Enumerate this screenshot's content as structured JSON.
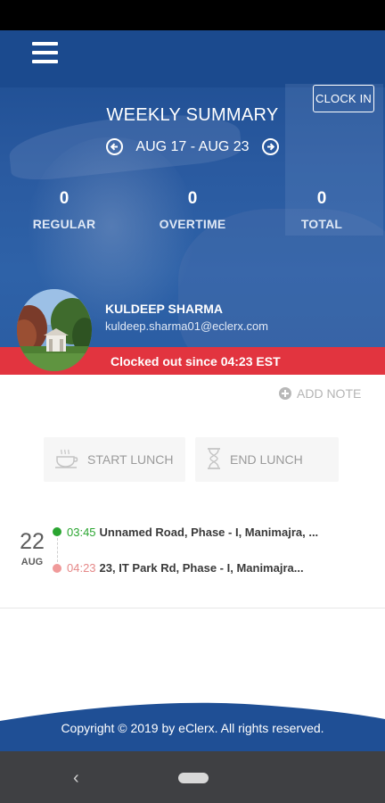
{
  "header": {
    "clock_in_label": "CLOCK IN",
    "title": "WEEKLY SUMMARY",
    "date_range": "AUG 17 - AUG 23"
  },
  "stats": [
    {
      "value": "0",
      "label": "REGULAR"
    },
    {
      "value": "0",
      "label": "OVERTIME"
    },
    {
      "value": "0",
      "label": "TOTAL"
    }
  ],
  "user": {
    "name": "KULDEEP SHARMA",
    "email": "kuldeep.sharma01@eclerx.com"
  },
  "status_banner": "Clocked out since 04:23 EST",
  "actions": {
    "add_note_label": "ADD NOTE",
    "start_lunch_label": "START LUNCH",
    "end_lunch_label": "END LUNCH"
  },
  "timeline": {
    "day": "22",
    "month": "AUG",
    "entries": [
      {
        "time": "03:45",
        "address": "Unnamed Road, Phase - I, Manimajra, ..."
      },
      {
        "time": "04:23",
        "address": "23, IT Park Rd, Phase - I, Manimajra..."
      }
    ]
  },
  "footer": {
    "copyright": "Copyright © 2019 by eClerx. All rights reserved."
  },
  "colors": {
    "primary": "#1f4f95",
    "banner_red": "#e2343f",
    "clock_in_green": "#2aa530",
    "clock_out_red": "#e58888"
  },
  "icons": [
    "hamburger-menu-icon",
    "arrow-left-circle-icon",
    "arrow-right-circle-icon",
    "add-circle-icon",
    "coffee-cup-icon",
    "hourglass-icon",
    "back-icon"
  ]
}
